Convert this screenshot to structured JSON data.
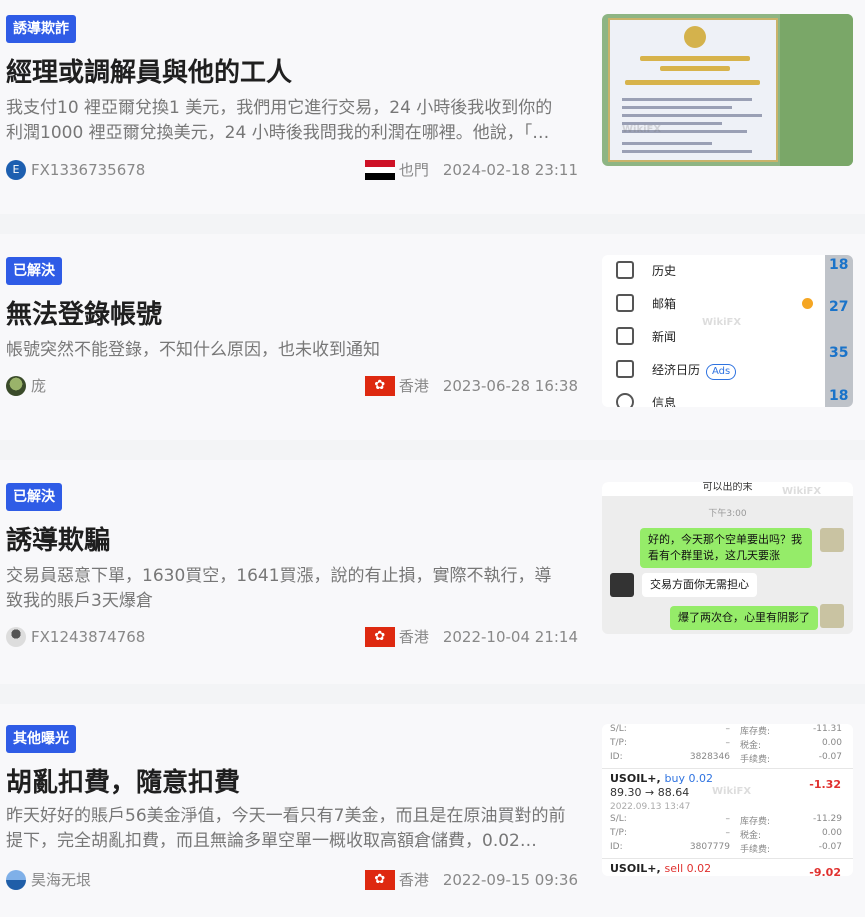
{
  "posts": [
    {
      "tag": "誘導欺詐",
      "title": "經理或調解員與他的工人",
      "desc": "我支付10 裡亞爾兌換1 美元，我們用它進行交易，24 小時後我收到你的利潤1000 裡亞爾兌換美元，24 小時後我問我的利潤在哪裡。他說，「…",
      "author": "FX1336735678",
      "author_initial": "E",
      "region": "也門",
      "datetime": "2024-02-18 23:11",
      "thumb_icon": "certificate-image"
    },
    {
      "tag": "已解決",
      "title": "無法登錄帳號",
      "desc": "帳號突然不能登錄，不知什么原因，也未收到通知",
      "author": "庞",
      "region": "香港",
      "datetime": "2023-06-28 16:38",
      "thumb_icon": "app-menu-screenshot"
    },
    {
      "tag": "已解決",
      "title": "誘導欺騙",
      "desc": "交易員惡意下單，1630買空，1641買漲，說的有止損，實際不執行，導致我的賬戶3天爆倉",
      "author": "FX1243874768",
      "region": "香港",
      "datetime": "2022-10-04 21:14",
      "thumb_icon": "chat-screenshot"
    },
    {
      "tag": "其他曝光",
      "title": "胡亂扣費，隨意扣費",
      "desc": "昨天好好的賬戶56美金淨值，今天一看只有7美金，而且是在原油買對的前提下，完全胡亂扣費，而且無論多單空單一概收取高額倉儲費，0.02…",
      "author": "昊海无垠",
      "region": "香港",
      "datetime": "2022-09-15 09:36",
      "thumb_icon": "trade-history-screenshot"
    }
  ],
  "thumb_menu": {
    "items": [
      "历史",
      "邮箱",
      "新闻",
      "经济日历",
      "信息"
    ],
    "ads_badge": "Ads",
    "side_numbers": [
      "18",
      "27",
      "35",
      "18"
    ]
  },
  "thumb_chat": {
    "time": "下午3:00",
    "msg1": "好的，今天那个空单要出吗？我看有个群里说，这几天要涨",
    "msg2": "交易方面你无需担心",
    "msg3": "爆了两次仓，心里有阴影了",
    "top_text": "可以出的末"
  },
  "thumb_trade": {
    "blocks": [
      {
        "sl_label": "S/L:",
        "sl_val": "–",
        "fee1_label": "库存费:",
        "fee1_val": "-11.31",
        "tp_label": "T/P:",
        "tp_val": "–",
        "fee2_label": "税金:",
        "fee2_val": "0.00",
        "id_label": "ID:",
        "id_val": "3828346",
        "fee3_label": "手续费:",
        "fee3_val": "-0.07",
        "symbol": "USOIL+,",
        "side": "buy 0.02",
        "prices": "89.30 → 88.64",
        "pl": "-1.32",
        "date": "2022.09.13 13:47"
      },
      {
        "sl_label": "S/L:",
        "sl_val": "–",
        "fee1_label": "库存费:",
        "fee1_val": "-11.29",
        "tp_label": "T/P:",
        "tp_val": "–",
        "fee2_label": "税金:",
        "fee2_val": "0.00",
        "id_label": "ID:",
        "id_val": "3807779",
        "fee3_label": "手续费:",
        "fee3_val": "-0.07",
        "symbol": "USOIL+,",
        "side": "sell 0.02",
        "pl": "-9.02"
      }
    ]
  },
  "watermark": "WikiFX",
  "colors": {
    "tag_bg": "#2f5ce6",
    "hk_flag": "#de2910",
    "loss": "#e0312f"
  }
}
